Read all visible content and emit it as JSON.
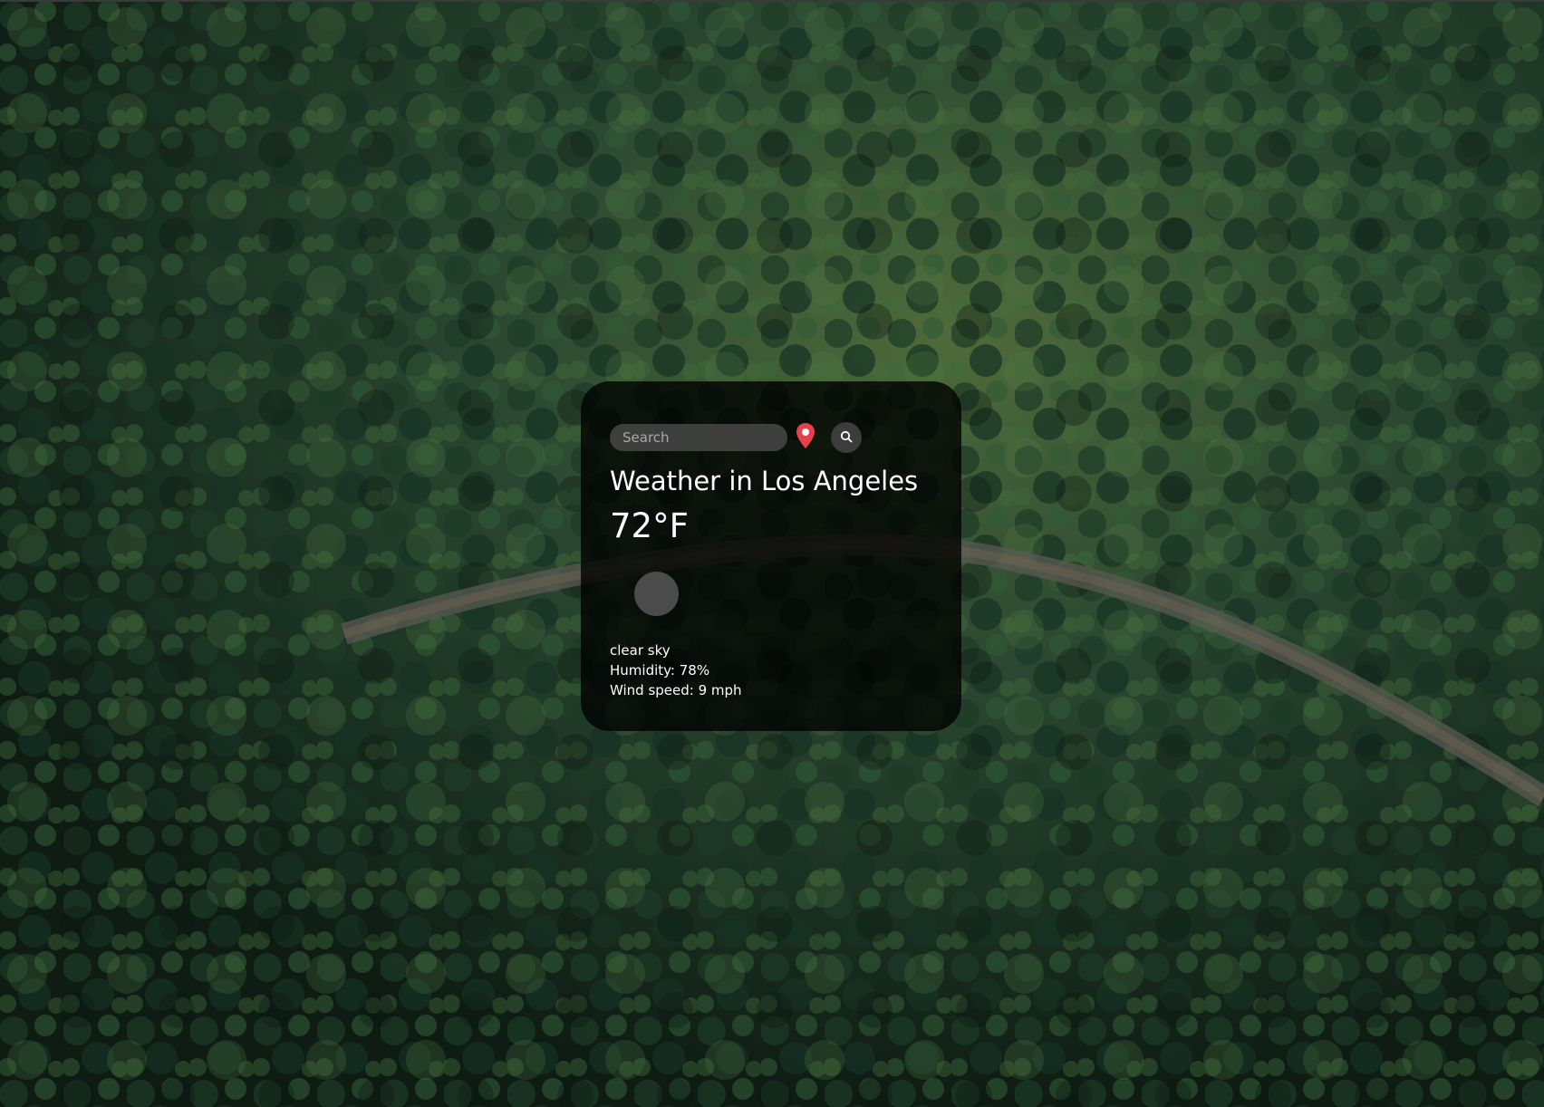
{
  "search": {
    "placeholder": "Search",
    "value": ""
  },
  "icons": {
    "location": "map-pin-icon",
    "search": "magnifier-icon",
    "weather": "weather-condition-icon"
  },
  "weather": {
    "title": "Weather in Los Angeles",
    "temperature": "72°F",
    "description": "clear sky",
    "humidity": "Humidity: 78%",
    "wind": "Wind speed: 9 mph"
  },
  "colors": {
    "pin": "#e8404a",
    "card_background": "rgba(0,0,0,0.78)",
    "text": "#ffffff"
  }
}
